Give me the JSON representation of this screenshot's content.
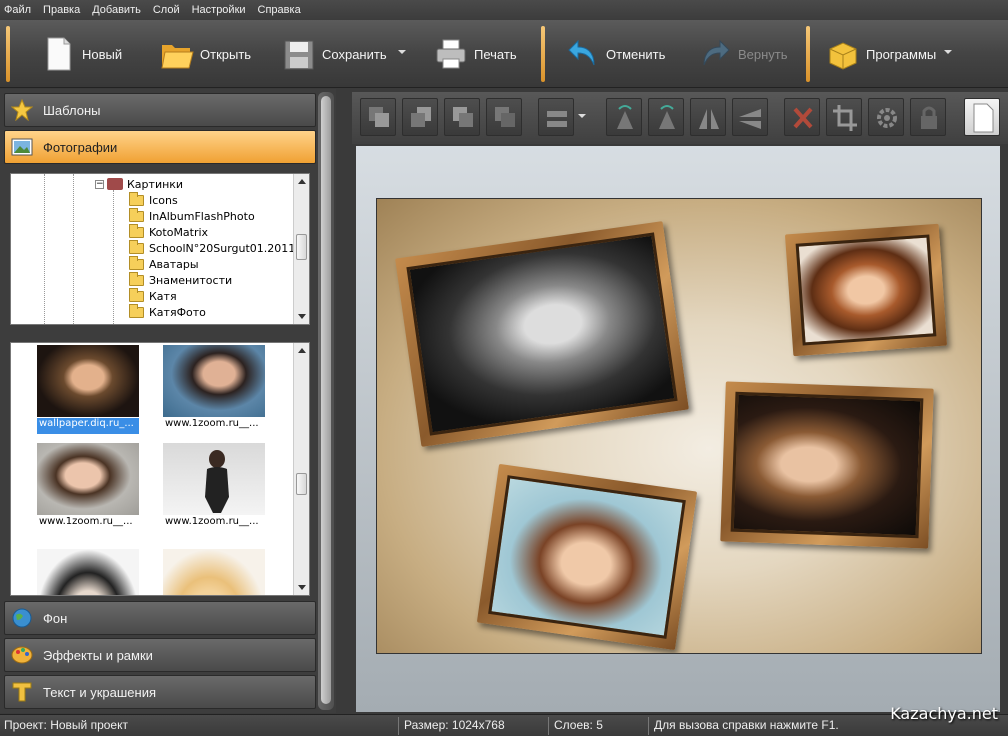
{
  "menu": [
    "Файл",
    "Правка",
    "Добавить",
    "Слой",
    "Настройки",
    "Справка"
  ],
  "toolbar": {
    "new_label": "Новый",
    "open_label": "Открыть",
    "save_label": "Сохранить",
    "print_label": "Печать",
    "undo_label": "Отменить",
    "redo_label": "Вернуть",
    "programs_label": "Программы"
  },
  "sidebar": {
    "templates_label": "Шаблоны",
    "photos_label": "Фотографии",
    "background_label": "Фон",
    "effects_label": "Эффекты и рамки",
    "text_label": "Текст и украшения"
  },
  "tree": {
    "root": "Картинки",
    "folders": [
      "Icons",
      "InAlbumFlashPhoto",
      "KotoMatrix",
      "SchoolN°20Surgut01.2011",
      "Аватары",
      "Знаменитости",
      "Катя",
      "КатяФото"
    ]
  },
  "thumbnails": [
    {
      "caption": "wallpaper.diq.ru_...",
      "selected": true
    },
    {
      "caption": "www.1zoom.ru__...",
      "selected": false
    },
    {
      "caption": "www.1zoom.ru__...",
      "selected": false
    },
    {
      "caption": "www.1zoom.ru__...",
      "selected": false
    }
  ],
  "status": {
    "project": "Проект: Новый проект",
    "size": "Размер: 1024x768",
    "layers": "Слоев: 5",
    "help": "Для вызова справки нажмите F1."
  },
  "watermark": "Kazachya.net",
  "colors": {
    "accent": "#f0a133",
    "selection": "#3a8ee6"
  }
}
